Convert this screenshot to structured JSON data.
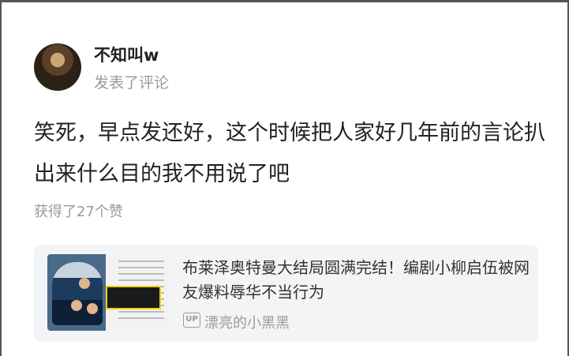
{
  "post": {
    "username": "不知叫w",
    "action": "发表了评论",
    "comment": "笑死，早点发还好，这个时候把人家好几年前的言论扒出来什么目的我不用说了吧",
    "likes": "获得了27个赞"
  },
  "linked_video": {
    "title": "布莱泽奥特曼大结局圆满完结！编剧小柳启伍被网友爆料辱华不当行为",
    "uploader_badge": "UP",
    "uploader": "漂亮的小黑黑"
  }
}
